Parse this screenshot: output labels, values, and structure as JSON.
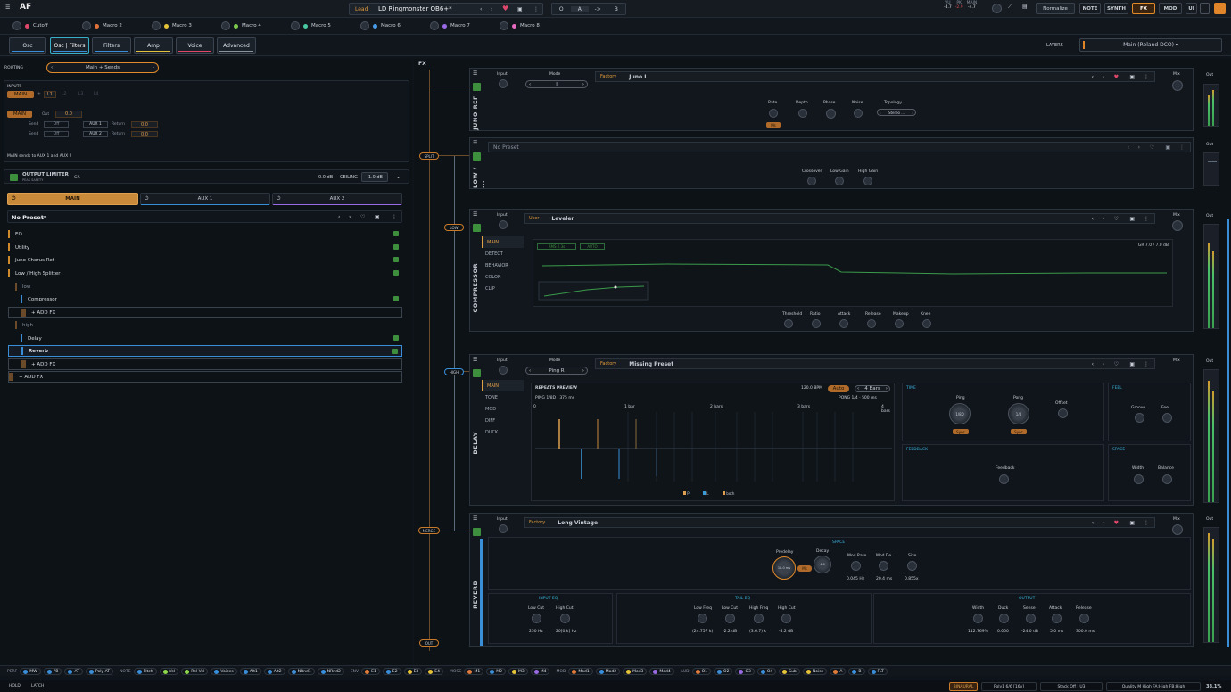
{
  "topbar": {
    "logo": "AF",
    "preset_type": "Lead",
    "preset_name": "LD Ringmonster OB6+*",
    "ab_o": "O",
    "ab_a": "A",
    "ab_arrow": "->",
    "ab_b": "B",
    "meters": [
      {
        "label": "VU",
        "value": "-4.7"
      },
      {
        "label": "PK",
        "value": "-2.9"
      },
      {
        "label": "MAIN",
        "value": "-4.7"
      }
    ],
    "normalize": "Normalize",
    "nav": [
      "NOTE",
      "SYNTH",
      "FX",
      "MOD",
      "UI"
    ]
  },
  "macros": [
    {
      "name": "Cutoff",
      "color": "#e0476b"
    },
    {
      "name": "Macro 2",
      "color": "#e0723a"
    },
    {
      "name": "Macro 3",
      "color": "#e6c23a"
    },
    {
      "name": "Macro 4",
      "color": "#7ac94a"
    },
    {
      "name": "Macro 5",
      "color": "#4ac9a0"
    },
    {
      "name": "Macro 6",
      "color": "#4a9ae6"
    },
    {
      "name": "Macro 7",
      "color": "#9a6ae6"
    },
    {
      "name": "Macro 8",
      "color": "#e66ac0"
    }
  ],
  "tabs": [
    "Osc",
    "Osc | Filters",
    "Filters",
    "Amp",
    "Voice",
    "Advanced"
  ],
  "layers": {
    "label": "LAYERS",
    "value": "Main (Roland DCO)"
  },
  "routing": {
    "label": "ROUTING",
    "value": "Main + Sends"
  },
  "inputs": {
    "label": "INPUTS",
    "main": "MAIN",
    "plus": "+",
    "l1": "L1",
    "l2": "L2",
    "l3": "L3",
    "l4": "L4"
  },
  "sends": {
    "main": "MAIN",
    "out_label": "Out",
    "out_value": "0.0",
    "send": "Send",
    "off": "Off",
    "aux1": "AUX 1",
    "aux2": "AUX 2",
    "return": "Return",
    "ret1": "0.0",
    "ret2": "0.0",
    "note": "MAIN sends to AUX 1 and AUX 2"
  },
  "limiter": {
    "title": "OUTPUT LIMITER",
    "sub": "PEAK SAFETY",
    "gr": "GR",
    "gr_value": "0.0 dB",
    "ceiling": "CEILING",
    "ceiling_value": "-1.0 dB"
  },
  "buses": [
    "MAIN",
    "AUX 1",
    "AUX 2"
  ],
  "chain": {
    "preset": "No Preset*",
    "items": [
      "EQ",
      "Utility",
      "Juno Chorus Ref",
      "Low / High Splitter"
    ],
    "low": "low",
    "compressor": "Compressor",
    "add_fx": "+ ADD FX",
    "high": "high",
    "delay": "Delay",
    "reverb": "Reverb"
  },
  "fx": {
    "title": "FX",
    "split": "SPLIT",
    "low": "LOW",
    "high": "HIGH",
    "merge": "MERGE",
    "out": "OUT"
  },
  "juno": {
    "vtitle": "JUNO REF",
    "input": "Input",
    "mode": "Mode",
    "mode_value": "I",
    "source": "Factory",
    "preset": "Juno I",
    "rate": "Rate",
    "rate_tag": "Ms",
    "depth": "Depth",
    "phase": "Phase",
    "noise": "Noise",
    "topology": "Topology",
    "topology_value": "Stereo ...",
    "mix": "Mix",
    "out": "Out"
  },
  "splitter": {
    "vtitle": "LOW / ...",
    "preset": "No Preset",
    "crossover": "Crossover",
    "low_gain": "Low Gain",
    "high_gain": "High Gain",
    "out": "Out"
  },
  "comp": {
    "vtitle": "COMPRESSOR",
    "input": "Input",
    "source": "User",
    "preset": "Leveler",
    "menu": [
      "MAIN",
      "DETECT",
      "BEHAVIOR",
      "COLOR",
      "CLIP"
    ],
    "mode1": "RMS 2.3s",
    "mode2": "AUTO",
    "gr_readout": "GR 7.0 / 7.0 dB",
    "knobs": [
      "Threshold",
      "Ratio",
      "Attack",
      "Release",
      "Makeup",
      "Knee"
    ],
    "mix": "Mix",
    "out": "Out"
  },
  "delay": {
    "vtitle": "DELAY",
    "input": "Input",
    "mode": "Mode",
    "mode_value": "Ping R",
    "source": "Factory",
    "preset": "Missing Preset",
    "menu": [
      "MAIN",
      "TONE",
      "MOD",
      "DIFF",
      "DUCK"
    ],
    "preview": "REPEATS PREVIEW",
    "bpm": "120.0 BPM",
    "auto": "Auto",
    "bars": "4 Bars",
    "ping": "PING 1/8D · 375 ms",
    "pong": "PONG 1/4 · 500 ms",
    "ticks": [
      "0",
      "1 bar",
      "2 bars",
      "3 bars",
      "4 bars"
    ],
    "time": "TIME",
    "ping_k": "Ping",
    "ping_v": "1/8D",
    "pong_k": "Pong",
    "pong_v": "1/4",
    "offset": "Offset",
    "sync": "Sync",
    "feel": "FEEL",
    "groove": "Groove",
    "feel_k": "Feel",
    "feedback": "FEEDBACK",
    "feedback_k": "Feedback",
    "space": "SPACE",
    "width": "Width",
    "balance": "Balance",
    "legend": [
      "P",
      "L",
      "both"
    ],
    "mix": "Mix",
    "out": "Out"
  },
  "reverb": {
    "vtitle": "REVERB",
    "input": "Input",
    "source": "Factory",
    "preset": "Long Vintage",
    "space": "SPACE",
    "predelay": "Predelay",
    "predelay_v": "18.0 ms",
    "ms": "Ms",
    "decay": "Decay",
    "decay_v": "4.6",
    "modrate": "Mod Rate",
    "modrate_v": "0.045 Hz",
    "moddepth": "Mod De...",
    "moddepth_v": "20.4 ms",
    "size": "Size",
    "size_v": "0.855x",
    "input_eq": "INPUT EQ",
    "low_cut": "Low Cut",
    "low_cut_v": "250 Hz",
    "high_cut": "High Cut",
    "high_cut_v": "20[0.k] Hz",
    "tail_eq": "TAIL EQ",
    "low_freq": "Low Freq",
    "low_freq_v": "(24.757 k)",
    "tail_low_cut": "Low Cut",
    "tail_low_cut_v": "-2.2 dB",
    "high_freq": "High Freq",
    "high_freq_v": "(3.6.7) k",
    "tail_high_cut": "High Cut",
    "tail_high_cut_v": "-4.2 dB",
    "output": "OUTPUT",
    "width": "Width",
    "width_v": "112.769%",
    "duck": "Duck",
    "duck_v": "0.000",
    "sense": "Sense",
    "sense_v": "-24.0 dB",
    "attack": "Attack",
    "attack_v": "5.0 ms",
    "release": "Release",
    "release_v": "300.0 ms",
    "mix": "Mix",
    "out": "Out"
  },
  "modbar": {
    "groups": [
      {
        "label": "PERF",
        "chips": [
          {
            "t": "MW",
            "c": "#3a8ed8"
          },
          {
            "t": "PB",
            "c": "#3a8ed8"
          },
          {
            "t": "AT",
            "c": "#3a8ed8"
          },
          {
            "t": "Poly AT",
            "c": "#3a8ed8"
          }
        ]
      },
      {
        "label": "NOTE",
        "chips": [
          {
            "t": "Pitch",
            "c": "#3a8ed8"
          },
          {
            "t": "Vel",
            "c": "#8bd84a"
          },
          {
            "t": "Rel Vel",
            "c": "#8bd84a"
          },
          {
            "t": "Voices",
            "c": "#3a8ed8"
          },
          {
            "t": "Alt1",
            "c": "#3a8ed8"
          },
          {
            "t": "Alt2",
            "c": "#3a8ed8"
          },
          {
            "t": "NRnd1",
            "c": "#3a8ed8"
          },
          {
            "t": "NRnd2",
            "c": "#3a8ed8"
          }
        ]
      },
      {
        "label": "ENV",
        "chips": [
          {
            "t": "E1",
            "c": "#e07b3a"
          },
          {
            "t": "E2",
            "c": "#3a8ed8"
          },
          {
            "t": "E3",
            "c": "#e6c23a"
          },
          {
            "t": "E4",
            "c": "#e6c23a"
          }
        ]
      },
      {
        "label": "MOSC",
        "chips": [
          {
            "t": "M1",
            "c": "#e07b3a"
          },
          {
            "t": "M2",
            "c": "#3a8ed8"
          },
          {
            "t": "M3",
            "c": "#e6c23a"
          },
          {
            "t": "M4",
            "c": "#9a6ae6"
          }
        ]
      },
      {
        "label": "MOD",
        "chips": [
          {
            "t": "Mod1",
            "c": "#e07b3a"
          },
          {
            "t": "Mod2",
            "c": "#3a8ed8"
          },
          {
            "t": "Mod3",
            "c": "#e6c23a"
          },
          {
            "t": "Mod4",
            "c": "#9a6ae6"
          }
        ]
      },
      {
        "label": "AUD",
        "chips": [
          {
            "t": "O1",
            "c": "#e07b3a"
          },
          {
            "t": "O2",
            "c": "#3a8ed8"
          },
          {
            "t": "O3",
            "c": "#9a6ae6"
          },
          {
            "t": "O4",
            "c": "#3a8ed8"
          },
          {
            "t": "Sub",
            "c": "#e6c23a"
          },
          {
            "t": "Noise",
            "c": "#e6c23a"
          },
          {
            "t": "A",
            "c": "#e07b3a"
          },
          {
            "t": "B",
            "c": "#3a8ed8"
          },
          {
            "t": "FLT",
            "c": "#3a8ed8"
          }
        ]
      }
    ]
  },
  "status": {
    "hold": "HOLD",
    "latch": "LATCH",
    "binaural": "BINAURAL",
    "poly": "Poly1 6/6 [16v]",
    "stack": "Stack Off | U3",
    "quality": "Quality M High FA:High FB:High",
    "cpu": "38.1%"
  }
}
